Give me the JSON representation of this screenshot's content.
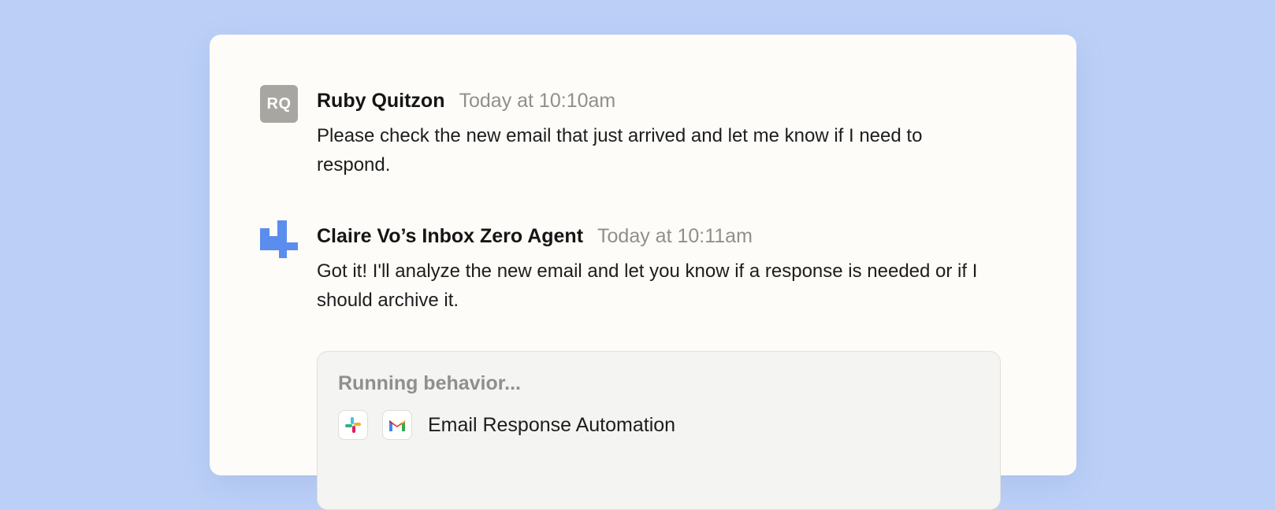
{
  "messages": [
    {
      "avatar_initials": "RQ",
      "author": "Ruby Quitzon",
      "timestamp": "Today at 10:10am",
      "text": "Please check the new email that just arrived and let me know if I need to respond."
    },
    {
      "avatar_icon": "agent-puzzle-icon",
      "author": "Claire Vo’s Inbox Zero Agent",
      "timestamp": "Today at 10:11am",
      "text": "Got it! I'll analyze the new email and let you know if a response is needed or if I should archive it."
    }
  ],
  "behavior": {
    "title": "Running behavior...",
    "apps": [
      "slack-icon",
      "gmail-icon"
    ],
    "name": "Email Response Automation"
  },
  "colors": {
    "page_background": "#bcd0f7",
    "card_background": "#fdfcf8",
    "agent_icon": "#5b8def",
    "avatar_background": "#a8a6a1",
    "muted_text": "#8f8f8c"
  }
}
